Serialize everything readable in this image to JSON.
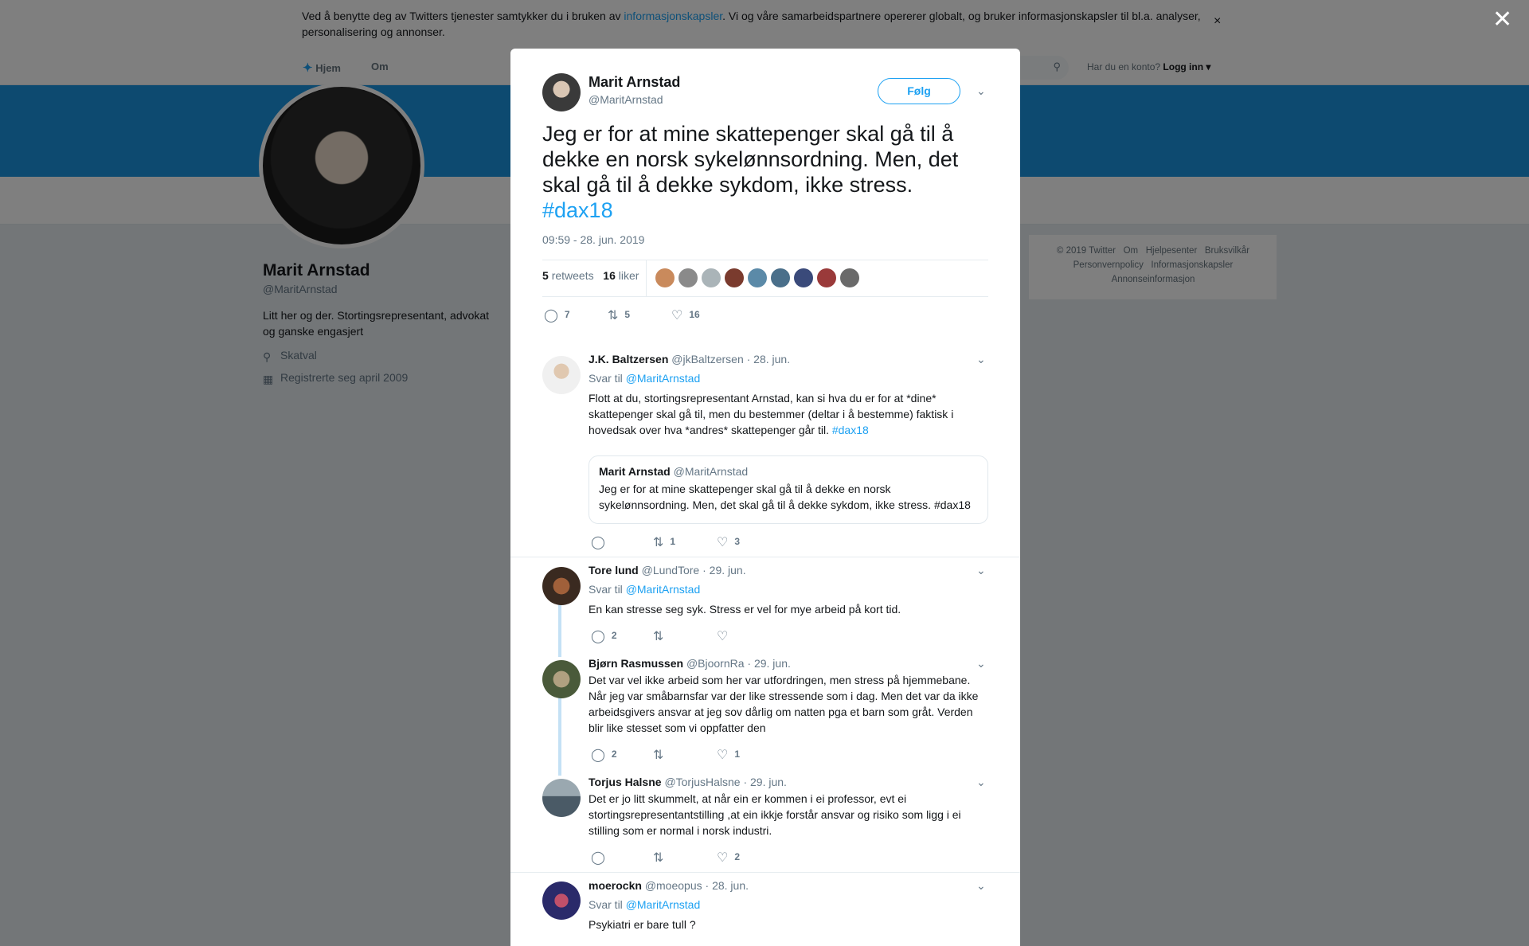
{
  "cookie_banner": {
    "text_before": "Ved å benytte deg av Twitters tjenester samtykker du i bruken av ",
    "link": "informasjonskapsler",
    "text_after": ". Vi og våre samarbeidspartnere opererer globalt, og bruker informasjonskapsler til bl.a. analyser, personalisering og annonser.",
    "close": "×"
  },
  "nav": {
    "home": "Hjem",
    "about": "Om",
    "login_prompt": "Har du en konto?",
    "login": "Logg inn"
  },
  "profile": {
    "name": "Marit Arnstad",
    "handle": "@MaritArnstad",
    "bio": "Litt her og der. Stortingsrepresentant, advokat og ganske engasjert",
    "location": "Skatval",
    "joined": "Registrerte seg april 2009"
  },
  "footer": {
    "line1": "© 2019 Twitter   Om   Hjelpesenter   Bruksvilkår",
    "line2": "Personvernpolicy   Informasjonskapsler",
    "line3": "Annonseinformasjon"
  },
  "overlay_close": "✕",
  "tweet": {
    "name": "Marit Arnstad",
    "handle": "@MaritArnstad",
    "follow": "Følg",
    "text": "Jeg er for at mine skattepenger skal gå til å dekke en norsk sykelønnsordning. Men, det skal gå til å dekke sykdom, ikke stress.",
    "hashtag": "#dax18",
    "time": "09:59 - 28. jun. 2019",
    "retweets_count": "5",
    "retweets_label": "retweets",
    "likes_count": "16",
    "likes_label": "liker",
    "replies": "7",
    "retweets": "5",
    "likes": "16"
  },
  "replies": [
    {
      "name": "J.K. Baltzersen",
      "handle": "@jkBaltzersen",
      "date": "· 28. jun.",
      "reply_to_label": "Svar til",
      "reply_to": "@MaritArnstad",
      "text": "Flott at du, stortingsrepresentant Arnstad, kan si hva du er for at *dine* skattepenger skal gå til, men du bestemmer (deltar i å bestemme) faktisk i hovedsak over hva *andres* skattepenger går til.",
      "hashtag": "#dax18",
      "quote_name": "Marit Arnstad",
      "quote_handle": "@MaritArnstad",
      "quote_text": "Jeg er for at mine skattepenger skal gå til å dekke en norsk sykelønnsordning. Men, det skal gå til å dekke sykdom, ikke stress. #dax18",
      "replies": "",
      "retweets": "1",
      "likes": "3"
    },
    {
      "name": "Tore lund",
      "handle": "@LundTore",
      "date": "· 29. jun.",
      "reply_to_label": "Svar til",
      "reply_to": "@MaritArnstad",
      "text": "En kan stresse seg syk. Stress er vel for mye arbeid på kort tid.",
      "replies": "2",
      "retweets": "",
      "likes": ""
    },
    {
      "name": "Bjørn Rasmussen",
      "handle": "@BjoornRa",
      "date": "· 29. jun.",
      "text": "Det var vel ikke arbeid som her var utfordringen, men stress på hjemmebane. Når jeg var småbarnsfar var der like stressende som i dag. Men det var da ikke arbeidsgivers ansvar at jeg sov dårlig om natten pga et barn som gråt. Verden blir like stesset som vi oppfatter den",
      "replies": "2",
      "retweets": "",
      "likes": "1"
    },
    {
      "name": "Torjus Halsne",
      "handle": "@TorjusHalsne",
      "date": "· 29. jun.",
      "text": "Det er jo litt skummelt, at når ein er kommen i ei professor, evt ei stortingsrepresentantstilling ,at ein ikkje forstår ansvar og risiko som ligg i ei stilling som er normal i norsk industri.",
      "replies": "",
      "retweets": "",
      "likes": "2"
    },
    {
      "name": "moerockn",
      "handle": "@moeopus",
      "date": "· 28. jun.",
      "reply_to_label": "Svar til",
      "reply_to": "@MaritArnstad",
      "text": "Psykiatri er bare tull ?"
    }
  ],
  "colors": {
    "accent": "#1da1f2",
    "banner": "#1b95e0",
    "thread": "#c4e1f5"
  }
}
